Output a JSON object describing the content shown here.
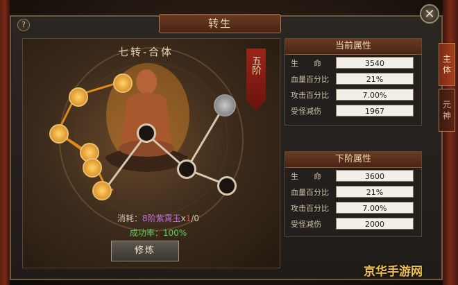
{
  "window": {
    "title": "转生",
    "help_label": "?",
    "close_label": "✕"
  },
  "stage": {
    "title": "七转-合体",
    "tier_badge": "五阶",
    "nodes": [
      {
        "state": "lit"
      },
      {
        "state": "lit"
      },
      {
        "state": "lit"
      },
      {
        "state": "lit"
      },
      {
        "state": "lit"
      },
      {
        "state": "lit"
      },
      {
        "state": "lit"
      },
      {
        "state": "locked"
      },
      {
        "state": "empty"
      },
      {
        "state": "empty"
      },
      {
        "state": "empty"
      }
    ],
    "cost_prefix": "消耗：",
    "cost_item": "8阶紫霄玉",
    "cost_mult": "x",
    "cost_need": "1",
    "cost_have": "/0",
    "success_rate": "成功率：100%",
    "train_button": "修炼"
  },
  "current": {
    "header": "当前属性",
    "rows": [
      {
        "label": "生　　命",
        "value": "3540"
      },
      {
        "label": "血量百分比",
        "value": "21%"
      },
      {
        "label": "攻击百分比",
        "value": "7.00%"
      },
      {
        "label": "受怪减伤",
        "value": "1967"
      }
    ]
  },
  "next": {
    "header": "下阶属性",
    "rows": [
      {
        "label": "生　　命",
        "value": "3600"
      },
      {
        "label": "血量百分比",
        "value": "21%"
      },
      {
        "label": "攻击百分比",
        "value": "7.00%"
      },
      {
        "label": "受怪减伤",
        "value": "2000"
      }
    ]
  },
  "side_tabs": [
    {
      "label": "主\n体",
      "active": true
    },
    {
      "label": "元\n神",
      "active": false
    }
  ],
  "watermark": "京华手游网",
  "colors": {
    "accent": "#a8401e",
    "gold": "#f2c24a",
    "success": "#5cd05a",
    "purple": "#c26ee0",
    "red": "#e84b3c"
  }
}
